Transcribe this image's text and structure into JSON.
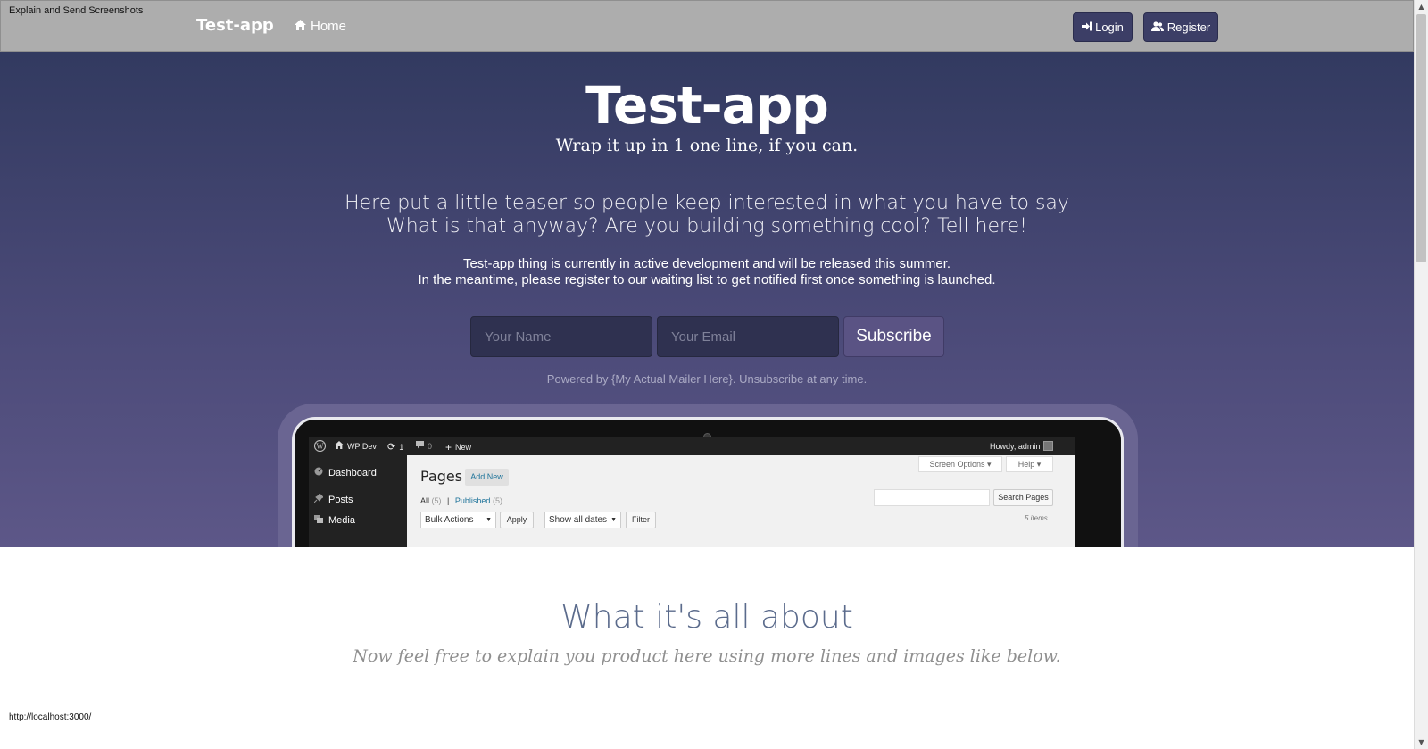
{
  "window": {
    "title": "Explain and Send Screenshots",
    "status_url": "http://localhost:3000/"
  },
  "navbar": {
    "brand": "Test-app",
    "home_label": "Home",
    "login_label": "Login",
    "register_label": "Register"
  },
  "hero": {
    "title": "Test-app",
    "tagline": "Wrap it up in 1 one line, if you can.",
    "teaser_line1": "Here put a little teaser so people keep interested in what you have to say",
    "teaser_line2": "What is that anyway? Are you building something cool? Tell here!",
    "info_line1": "Test-app thing is currently in active development and will be released this summer.",
    "info_line2": "In the meantime, please register to our waiting list to get notified first once something is launched.",
    "name_placeholder": "Your Name",
    "email_placeholder": "Your Email",
    "subscribe_label": "Subscribe",
    "powered_by": "Powered by {My Actual Mailer Here}. Unsubscribe at any time."
  },
  "mockup": {
    "adminbar": {
      "site": "WP Dev",
      "updates": "1",
      "comments": "0",
      "new": "New",
      "howdy": "Howdy, admin"
    },
    "sidebar": [
      "Dashboard",
      "Posts",
      "Media"
    ],
    "page_title": "Pages",
    "add_new": "Add New",
    "screen_options": "Screen Options",
    "help": "Help",
    "filter_all": "All",
    "filter_all_count": "(5)",
    "filter_sep": "|",
    "filter_published": "Published",
    "filter_published_count": "(5)",
    "search_button": "Search Pages",
    "bulk_actions": "Bulk Actions",
    "apply": "Apply",
    "dates": "Show all dates",
    "filter_button": "Filter",
    "items": "5 items"
  },
  "about": {
    "title": "What it's all about",
    "subtitle": "Now feel free to explain you product here using more lines and images like below."
  },
  "colors": {
    "navbar_bg": "#adadad",
    "hero_top": "#323a60",
    "hero_bottom": "#5d5788",
    "button_bg": "#3c3e66",
    "about_title": "#5b6b8c"
  }
}
